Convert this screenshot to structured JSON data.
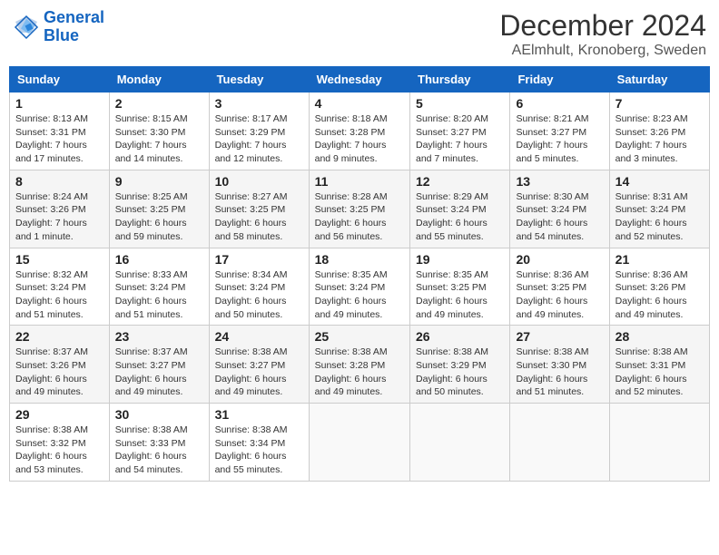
{
  "header": {
    "logo_line1": "General",
    "logo_line2": "Blue",
    "month": "December 2024",
    "location": "AElmhult, Kronoberg, Sweden"
  },
  "weekdays": [
    "Sunday",
    "Monday",
    "Tuesday",
    "Wednesday",
    "Thursday",
    "Friday",
    "Saturday"
  ],
  "weeks": [
    [
      {
        "day": "1",
        "sunrise": "8:13 AM",
        "sunset": "3:31 PM",
        "daylight": "7 hours and 17 minutes."
      },
      {
        "day": "2",
        "sunrise": "8:15 AM",
        "sunset": "3:30 PM",
        "daylight": "7 hours and 14 minutes."
      },
      {
        "day": "3",
        "sunrise": "8:17 AM",
        "sunset": "3:29 PM",
        "daylight": "7 hours and 12 minutes."
      },
      {
        "day": "4",
        "sunrise": "8:18 AM",
        "sunset": "3:28 PM",
        "daylight": "7 hours and 9 minutes."
      },
      {
        "day": "5",
        "sunrise": "8:20 AM",
        "sunset": "3:27 PM",
        "daylight": "7 hours and 7 minutes."
      },
      {
        "day": "6",
        "sunrise": "8:21 AM",
        "sunset": "3:27 PM",
        "daylight": "7 hours and 5 minutes."
      },
      {
        "day": "7",
        "sunrise": "8:23 AM",
        "sunset": "3:26 PM",
        "daylight": "7 hours and 3 minutes."
      }
    ],
    [
      {
        "day": "8",
        "sunrise": "8:24 AM",
        "sunset": "3:26 PM",
        "daylight": "7 hours and 1 minute."
      },
      {
        "day": "9",
        "sunrise": "8:25 AM",
        "sunset": "3:25 PM",
        "daylight": "6 hours and 59 minutes."
      },
      {
        "day": "10",
        "sunrise": "8:27 AM",
        "sunset": "3:25 PM",
        "daylight": "6 hours and 58 minutes."
      },
      {
        "day": "11",
        "sunrise": "8:28 AM",
        "sunset": "3:25 PM",
        "daylight": "6 hours and 56 minutes."
      },
      {
        "day": "12",
        "sunrise": "8:29 AM",
        "sunset": "3:24 PM",
        "daylight": "6 hours and 55 minutes."
      },
      {
        "day": "13",
        "sunrise": "8:30 AM",
        "sunset": "3:24 PM",
        "daylight": "6 hours and 54 minutes."
      },
      {
        "day": "14",
        "sunrise": "8:31 AM",
        "sunset": "3:24 PM",
        "daylight": "6 hours and 52 minutes."
      }
    ],
    [
      {
        "day": "15",
        "sunrise": "8:32 AM",
        "sunset": "3:24 PM",
        "daylight": "6 hours and 51 minutes."
      },
      {
        "day": "16",
        "sunrise": "8:33 AM",
        "sunset": "3:24 PM",
        "daylight": "6 hours and 51 minutes."
      },
      {
        "day": "17",
        "sunrise": "8:34 AM",
        "sunset": "3:24 PM",
        "daylight": "6 hours and 50 minutes."
      },
      {
        "day": "18",
        "sunrise": "8:35 AM",
        "sunset": "3:24 PM",
        "daylight": "6 hours and 49 minutes."
      },
      {
        "day": "19",
        "sunrise": "8:35 AM",
        "sunset": "3:25 PM",
        "daylight": "6 hours and 49 minutes."
      },
      {
        "day": "20",
        "sunrise": "8:36 AM",
        "sunset": "3:25 PM",
        "daylight": "6 hours and 49 minutes."
      },
      {
        "day": "21",
        "sunrise": "8:36 AM",
        "sunset": "3:26 PM",
        "daylight": "6 hours and 49 minutes."
      }
    ],
    [
      {
        "day": "22",
        "sunrise": "8:37 AM",
        "sunset": "3:26 PM",
        "daylight": "6 hours and 49 minutes."
      },
      {
        "day": "23",
        "sunrise": "8:37 AM",
        "sunset": "3:27 PM",
        "daylight": "6 hours and 49 minutes."
      },
      {
        "day": "24",
        "sunrise": "8:38 AM",
        "sunset": "3:27 PM",
        "daylight": "6 hours and 49 minutes."
      },
      {
        "day": "25",
        "sunrise": "8:38 AM",
        "sunset": "3:28 PM",
        "daylight": "6 hours and 49 minutes."
      },
      {
        "day": "26",
        "sunrise": "8:38 AM",
        "sunset": "3:29 PM",
        "daylight": "6 hours and 50 minutes."
      },
      {
        "day": "27",
        "sunrise": "8:38 AM",
        "sunset": "3:30 PM",
        "daylight": "6 hours and 51 minutes."
      },
      {
        "day": "28",
        "sunrise": "8:38 AM",
        "sunset": "3:31 PM",
        "daylight": "6 hours and 52 minutes."
      }
    ],
    [
      {
        "day": "29",
        "sunrise": "8:38 AM",
        "sunset": "3:32 PM",
        "daylight": "6 hours and 53 minutes."
      },
      {
        "day": "30",
        "sunrise": "8:38 AM",
        "sunset": "3:33 PM",
        "daylight": "6 hours and 54 minutes."
      },
      {
        "day": "31",
        "sunrise": "8:38 AM",
        "sunset": "3:34 PM",
        "daylight": "6 hours and 55 minutes."
      },
      null,
      null,
      null,
      null
    ]
  ]
}
